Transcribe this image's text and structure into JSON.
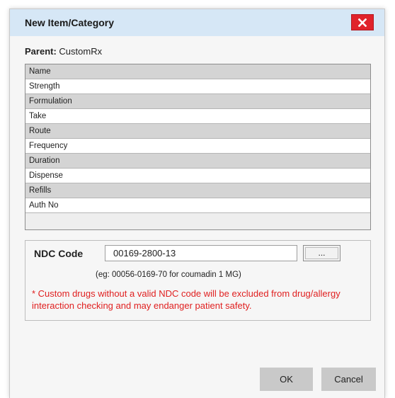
{
  "dialog": {
    "title": "New Item/Category",
    "close_icon": "close-x-icon",
    "accent_color": "#e0232b",
    "titlebar_color": "#d6e7f6"
  },
  "parent": {
    "label": "Parent:",
    "value": "CustomRx"
  },
  "fields": [
    {
      "label": "Name"
    },
    {
      "label": "Strength"
    },
    {
      "label": "Formulation"
    },
    {
      "label": "Take"
    },
    {
      "label": "Route"
    },
    {
      "label": "Frequency"
    },
    {
      "label": "Duration"
    },
    {
      "label": "Dispense"
    },
    {
      "label": "Refills"
    },
    {
      "label": "Auth No"
    }
  ],
  "ndc": {
    "label": "NDC Code",
    "value": "00169-2800-13",
    "browse_label": "...",
    "hint": "(eg: 00056-0169-70 for coumadin 1 MG)",
    "warning": "* Custom drugs without a valid NDC code will be excluded from drug/allergy interaction checking and may endanger patient safety.",
    "warning_color": "#e02020"
  },
  "buttons": {
    "ok": "OK",
    "cancel": "Cancel"
  }
}
